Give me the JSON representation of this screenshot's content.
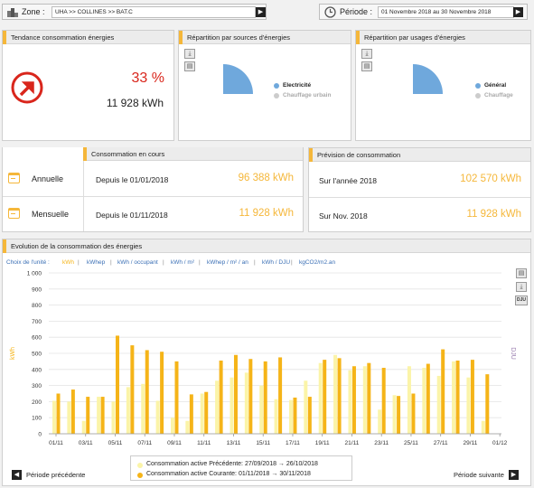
{
  "header": {
    "zone_label": "Zone :",
    "zone_value": "UHA >> COLLINES >> BAT.C",
    "period_label": "Période :",
    "period_value": "01 Novembre 2018 au 30 Novembre 2018"
  },
  "trend": {
    "title": "Tendance consommation énergies",
    "percent": "33 %",
    "kwh": "11 928 kWh",
    "accent_color": "#d9261c"
  },
  "sources": {
    "title": "Répartition par sources d'énergies",
    "legend": [
      "Electricité",
      "Chauffage urbain"
    ],
    "colors": [
      "#6fa8dc",
      "#cccccc"
    ]
  },
  "usages": {
    "title": "Répartition par usages d'énergies",
    "legend": [
      "Général",
      "Chauffage"
    ],
    "colors": [
      "#6fa8dc",
      "#cccccc"
    ]
  },
  "consumption": {
    "title": "Consommation en cours",
    "rows": [
      {
        "label": "Annuelle",
        "since": "Depuis le 01/01/2018",
        "value": "96 388 kWh"
      },
      {
        "label": "Mensuelle",
        "since": "Depuis le 01/11/2018",
        "value": "11 928 kWh"
      }
    ]
  },
  "forecast": {
    "title": "Prévision de consommation",
    "rows": [
      {
        "label": "Sur l'année 2018",
        "value": "102 570 kWh"
      },
      {
        "label": "Sur Nov. 2018",
        "value": "11 928 kWh"
      }
    ]
  },
  "evolution": {
    "title": "Evolution de la consommation des énergies",
    "unit_choice_label": "Choix de l'unité :",
    "units": [
      "kWh",
      "kWhep",
      "kWh / occupant",
      "kWh / m²",
      "kWhep / m² / an",
      "kWh / DJU",
      "kgCO2/m2.an"
    ],
    "selected_unit": "kWh",
    "prev_button": "Période précédente",
    "next_button": "Période suivante",
    "dju_label": "DJU"
  },
  "chart_data": {
    "type": "bar",
    "ylabel": "kWh",
    "y2label": "DJU",
    "ylim": [
      0,
      1000
    ],
    "yticks": [
      "0",
      "100",
      "200",
      "300",
      "400",
      "500",
      "600",
      "700",
      "800",
      "900",
      "1 000"
    ],
    "xticks": [
      "01/11",
      "03/11",
      "05/11",
      "07/11",
      "09/11",
      "11/11",
      "13/11",
      "15/11",
      "17/11",
      "19/11",
      "21/11",
      "23/11",
      "25/11",
      "27/11",
      "29/11",
      "01/12"
    ],
    "colors": {
      "previous": "#fbf4a8",
      "current": "#f5b418"
    },
    "series": [
      {
        "name": "Consommation active Précédente: 27/09/2018 → 26/10/2018",
        "values": [
          205,
          200,
          80,
          230,
          200,
          290,
          310,
          205,
          100,
          80,
          250,
          330,
          350,
          380,
          300,
          215,
          210,
          330,
          440,
          490,
          395,
          420,
          150,
          240,
          420,
          410,
          360,
          450,
          350,
          80
        ]
      },
      {
        "name": "Consommation active Courante: 01/11/2018 → 30/11/2018",
        "values": [
          250,
          275,
          230,
          230,
          610,
          550,
          520,
          510,
          450,
          245,
          260,
          455,
          490,
          465,
          450,
          475,
          225,
          230,
          460,
          470,
          420,
          440,
          410,
          235,
          250,
          435,
          525,
          455,
          460,
          370
        ]
      }
    ]
  }
}
